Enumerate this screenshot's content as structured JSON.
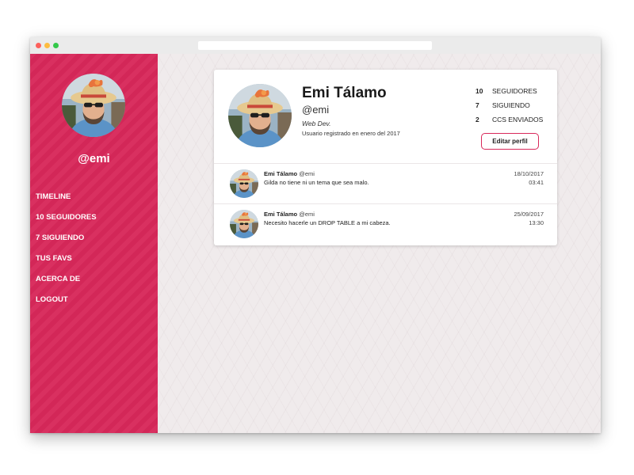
{
  "sidebar": {
    "handle": "@emi",
    "nav": [
      "TIMELINE",
      "10 SEGUIDORES",
      "7 SIGUIENDO",
      "TUS FAVS",
      "ACERCA DE",
      "LOGOUT"
    ]
  },
  "profile": {
    "name": "Emi Tálamo",
    "handle": "@emi",
    "role": "Web Dev.",
    "since": "Usuario registrado en enero del 2017",
    "stats": [
      {
        "num": "10",
        "label": "SEGUIDORES"
      },
      {
        "num": "7",
        "label": "SIGUIENDO"
      },
      {
        "num": "2",
        "label": "CCS ENVIADOS"
      }
    ],
    "edit_label": "Editar perfil"
  },
  "posts": [
    {
      "author": "Emi Tálamo",
      "handle": "@emi",
      "text": "Gilda no tiene ni un tema que sea malo.",
      "date": "18/10/2017",
      "time": "03:41"
    },
    {
      "author": "Emi Tálamo",
      "handle": "@emi",
      "text": "Necesito hacerle un DROP TABLE a mi cabeza.",
      "date": "25/09/2017",
      "time": "13:30"
    }
  ],
  "colors": {
    "accent": "#d8285a",
    "background": "#f0ebec",
    "card": "#ffffff"
  },
  "icons": {
    "avatar": "user-avatar-photo"
  }
}
